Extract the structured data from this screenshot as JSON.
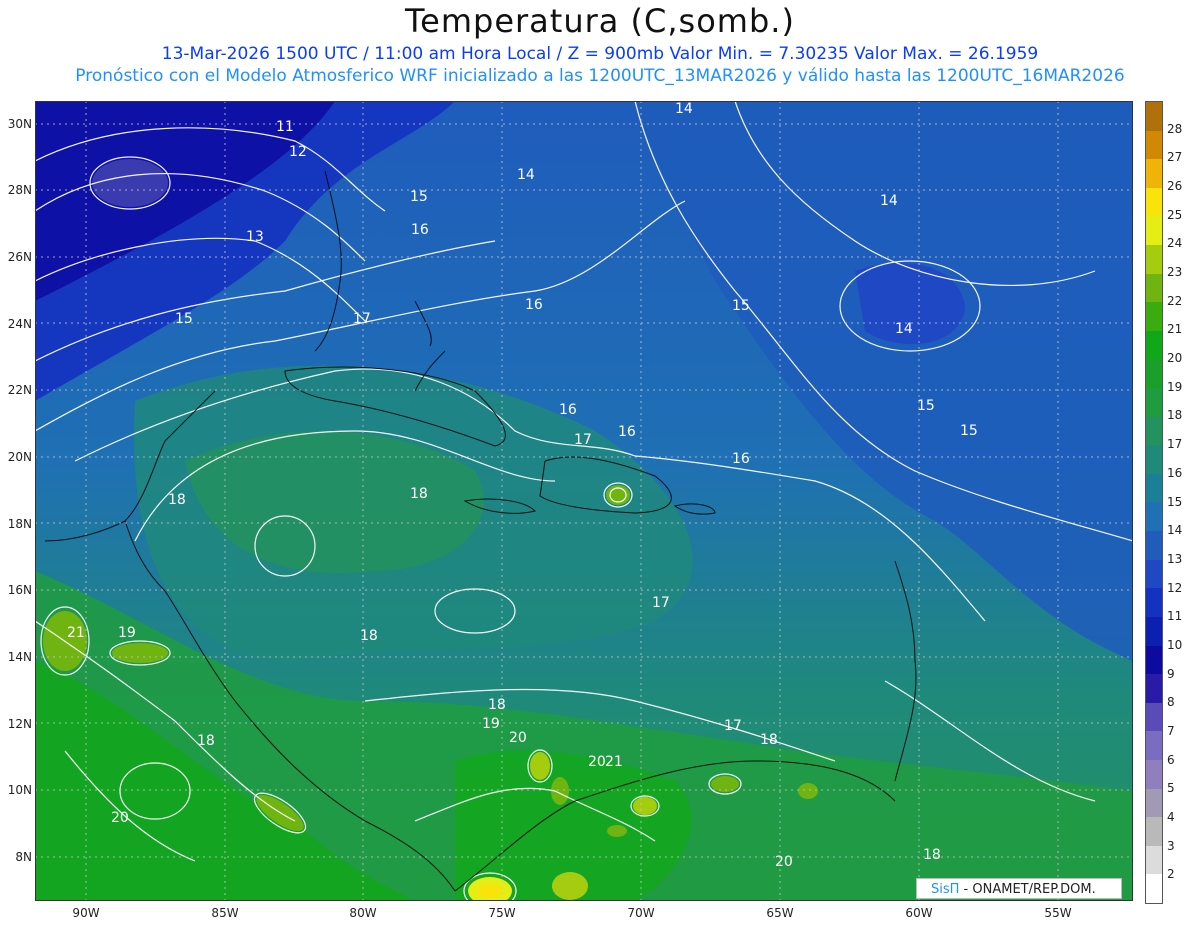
{
  "header": {
    "title": "Temperatura (C,somb.)",
    "line1": "13-Mar-2026  1500 UTC / 11:00 am Hora Local / Z = 900mb   Valor Min. = 7.30235  Valor Max. = 26.1959",
    "line2": "Pronóstico con el Modelo Atmosferico WRF inicializado a las 1200UTC_13MAR2026 y válido hasta las  1200UTC_16MAR2026"
  },
  "axes": {
    "lat_labels": [
      "30N",
      "28N",
      "26N",
      "24N",
      "22N",
      "20N",
      "18N",
      "16N",
      "14N",
      "12N",
      "10N",
      "8N"
    ],
    "lon_labels": [
      "90W",
      "85W",
      "80W",
      "75W",
      "70W",
      "65W",
      "60W",
      "55W"
    ]
  },
  "colorbar": {
    "labels": [
      "2",
      "3",
      "4",
      "5",
      "6",
      "7",
      "8",
      "9",
      "10",
      "11",
      "12",
      "13",
      "14",
      "15",
      "16",
      "17",
      "18",
      "19",
      "20",
      "21",
      "22",
      "23",
      "24",
      "25",
      "26",
      "27",
      "28"
    ],
    "colors": [
      "#ffffff",
      "#dcdcdc",
      "#b9b9b9",
      "#a09ab4",
      "#8f7fbf",
      "#7a6cc0",
      "#5a4bb8",
      "#2a1aa8",
      "#0d0aa0",
      "#0b1fb0",
      "#1432c0",
      "#1f48c4",
      "#1f5cbc",
      "#1f70b4",
      "#1b7f98",
      "#1f8a7a",
      "#23925e",
      "#209c40",
      "#1aa02a",
      "#10a818",
      "#3aac10",
      "#6fb410",
      "#a6cc10",
      "#e4ee14",
      "#f8e40a",
      "#f0b408",
      "#d08806",
      "#b0700a"
    ]
  },
  "contour_labels": [
    "11",
    "12",
    "13",
    "14",
    "14",
    "14",
    "14",
    "15",
    "15",
    "15",
    "15",
    "15",
    "16",
    "16",
    "16",
    "16",
    "16",
    "17",
    "17",
    "17",
    "17",
    "18",
    "18",
    "18",
    "18",
    "18",
    "18",
    "18",
    "19",
    "19",
    "20",
    "20",
    "20",
    "20",
    "21",
    "21"
  ],
  "footer": {
    "logo_a": "SisΠ",
    "logo_b": " - ONAMET/REP.DOM."
  }
}
